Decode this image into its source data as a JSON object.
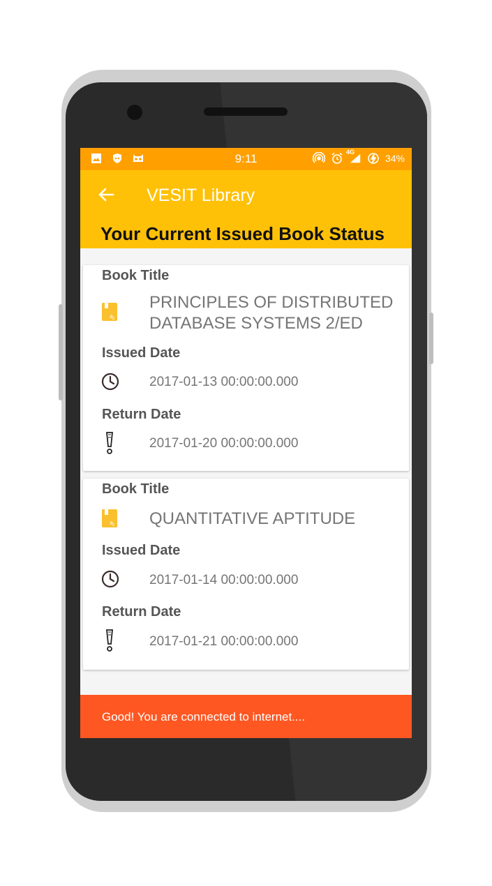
{
  "status_bar": {
    "time": "9:11",
    "network": "4G",
    "battery": "34%",
    "icons_left": [
      "image-icon",
      "shield-icon",
      "cat-icon"
    ],
    "icons_right": [
      "hotspot-icon",
      "alarm-icon",
      "signal-icon",
      "battery-charging-icon"
    ]
  },
  "app_bar": {
    "title": "VESIT Library",
    "heading": "Your Current Issued Book Status"
  },
  "labels": {
    "book_title": "Book Title",
    "issued_date": "Issued Date",
    "return_date": "Return Date"
  },
  "books": [
    {
      "title": "PRINCIPLES OF DISTRIBUTED DATABASE SYSTEMS 2/ED",
      "issued": "2017-01-13 00:00:00.000",
      "return": "2017-01-20 00:00:00.000"
    },
    {
      "title": "QUANTITATIVE APTITUDE",
      "issued": "2017-01-14 00:00:00.000",
      "return": "2017-01-21 00:00:00.000"
    }
  ],
  "snackbar": {
    "message": "Good! You are connected to internet...."
  },
  "colors": {
    "status_bar": "#ffa000",
    "app_bar": "#ffc107",
    "snackbar": "#ff5722",
    "book_icon": "#fbc02d"
  }
}
